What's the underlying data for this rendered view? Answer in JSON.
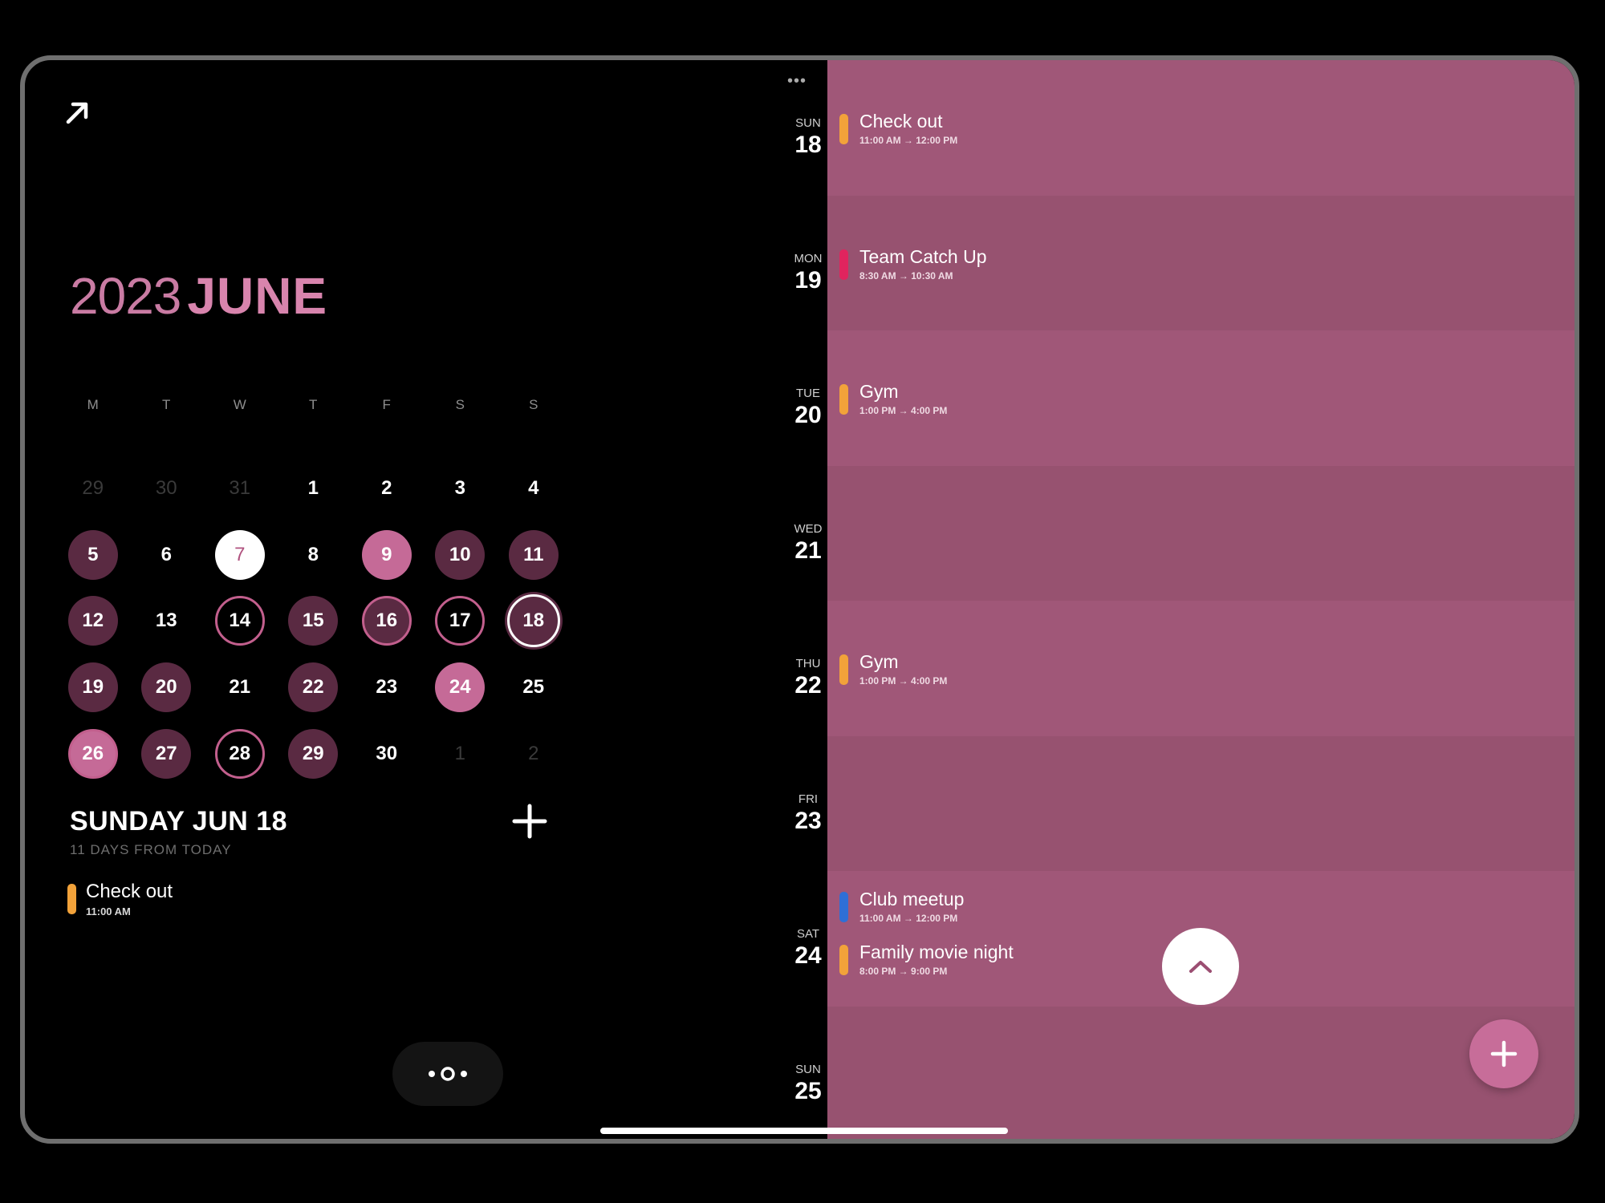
{
  "calendar": {
    "year": "2023",
    "month": "JUNE",
    "weekdays": [
      "M",
      "T",
      "W",
      "T",
      "F",
      "S",
      "S"
    ],
    "days": [
      {
        "n": "29",
        "s": "outside"
      },
      {
        "n": "30",
        "s": "outside"
      },
      {
        "n": "31",
        "s": "outside"
      },
      {
        "n": "1",
        "s": ""
      },
      {
        "n": "2",
        "s": ""
      },
      {
        "n": "3",
        "s": ""
      },
      {
        "n": "4",
        "s": ""
      },
      {
        "n": "5",
        "s": "dark"
      },
      {
        "n": "6",
        "s": ""
      },
      {
        "n": "7",
        "s": "today"
      },
      {
        "n": "8",
        "s": ""
      },
      {
        "n": "9",
        "s": "light"
      },
      {
        "n": "10",
        "s": "dark"
      },
      {
        "n": "11",
        "s": "dark"
      },
      {
        "n": "12",
        "s": "dark"
      },
      {
        "n": "13",
        "s": ""
      },
      {
        "n": "14",
        "s": "ring"
      },
      {
        "n": "15",
        "s": "dark"
      },
      {
        "n": "16",
        "s": "dark ring"
      },
      {
        "n": "17",
        "s": "ring"
      },
      {
        "n": "18",
        "s": "selected"
      },
      {
        "n": "19",
        "s": "dark"
      },
      {
        "n": "20",
        "s": "dark"
      },
      {
        "n": "21",
        "s": ""
      },
      {
        "n": "22",
        "s": "dark"
      },
      {
        "n": "23",
        "s": ""
      },
      {
        "n": "24",
        "s": "light"
      },
      {
        "n": "25",
        "s": ""
      },
      {
        "n": "26",
        "s": "light ring"
      },
      {
        "n": "27",
        "s": "dark"
      },
      {
        "n": "28",
        "s": "ring"
      },
      {
        "n": "29",
        "s": "dark"
      },
      {
        "n": "30",
        "s": ""
      },
      {
        "n": "1",
        "s": "outside"
      },
      {
        "n": "2",
        "s": "outside"
      }
    ]
  },
  "selected_day": {
    "title": "SUNDAY JUN 18",
    "subtitle": "11 DAYS FROM TODAY",
    "events": [
      {
        "title": "Check out",
        "time": "11:00 AM",
        "color": "#f2a23a"
      }
    ]
  },
  "agenda": {
    "days": [
      {
        "dow": "SUN",
        "num": "18",
        "events": [
          {
            "title": "Check out",
            "time": "11:00 AM → 12:00 PM",
            "color": "#f2a23a"
          }
        ]
      },
      {
        "dow": "MON",
        "num": "19",
        "events": [
          {
            "title": "Team Catch Up",
            "time": "8:30 AM → 10:30 AM",
            "color": "#e0245e"
          }
        ]
      },
      {
        "dow": "TUE",
        "num": "20",
        "events": [
          {
            "title": "Gym",
            "time": "1:00 PM → 4:00 PM",
            "color": "#f2a23a"
          }
        ]
      },
      {
        "dow": "WED",
        "num": "21",
        "events": []
      },
      {
        "dow": "THU",
        "num": "22",
        "events": [
          {
            "title": "Gym",
            "time": "1:00 PM → 4:00 PM",
            "color": "#f2a23a"
          }
        ]
      },
      {
        "dow": "FRI",
        "num": "23",
        "events": []
      },
      {
        "dow": "SAT",
        "num": "24",
        "events": [
          {
            "title": "Club meetup",
            "time": "11:00 AM → 12:00 PM",
            "color": "#2f6fd6"
          },
          {
            "title": "Family movie night",
            "time": "8:00 PM → 9:00 PM",
            "color": "#f2a23a"
          }
        ]
      },
      {
        "dow": "SUN",
        "num": "25",
        "events": []
      }
    ]
  },
  "icons": {
    "expand": "arrow-up-right-icon",
    "more": "ellipsis-icon",
    "add": "plus-icon",
    "scroll_up": "chevron-up-icon",
    "view_toggle": "view-toggle-icon"
  },
  "colors": {
    "accent": "#d884ad",
    "band_light": "#a05778",
    "band_dark": "#975270",
    "event_orange": "#f2a23a",
    "event_red": "#e0245e",
    "event_blue": "#2f6fd6"
  }
}
